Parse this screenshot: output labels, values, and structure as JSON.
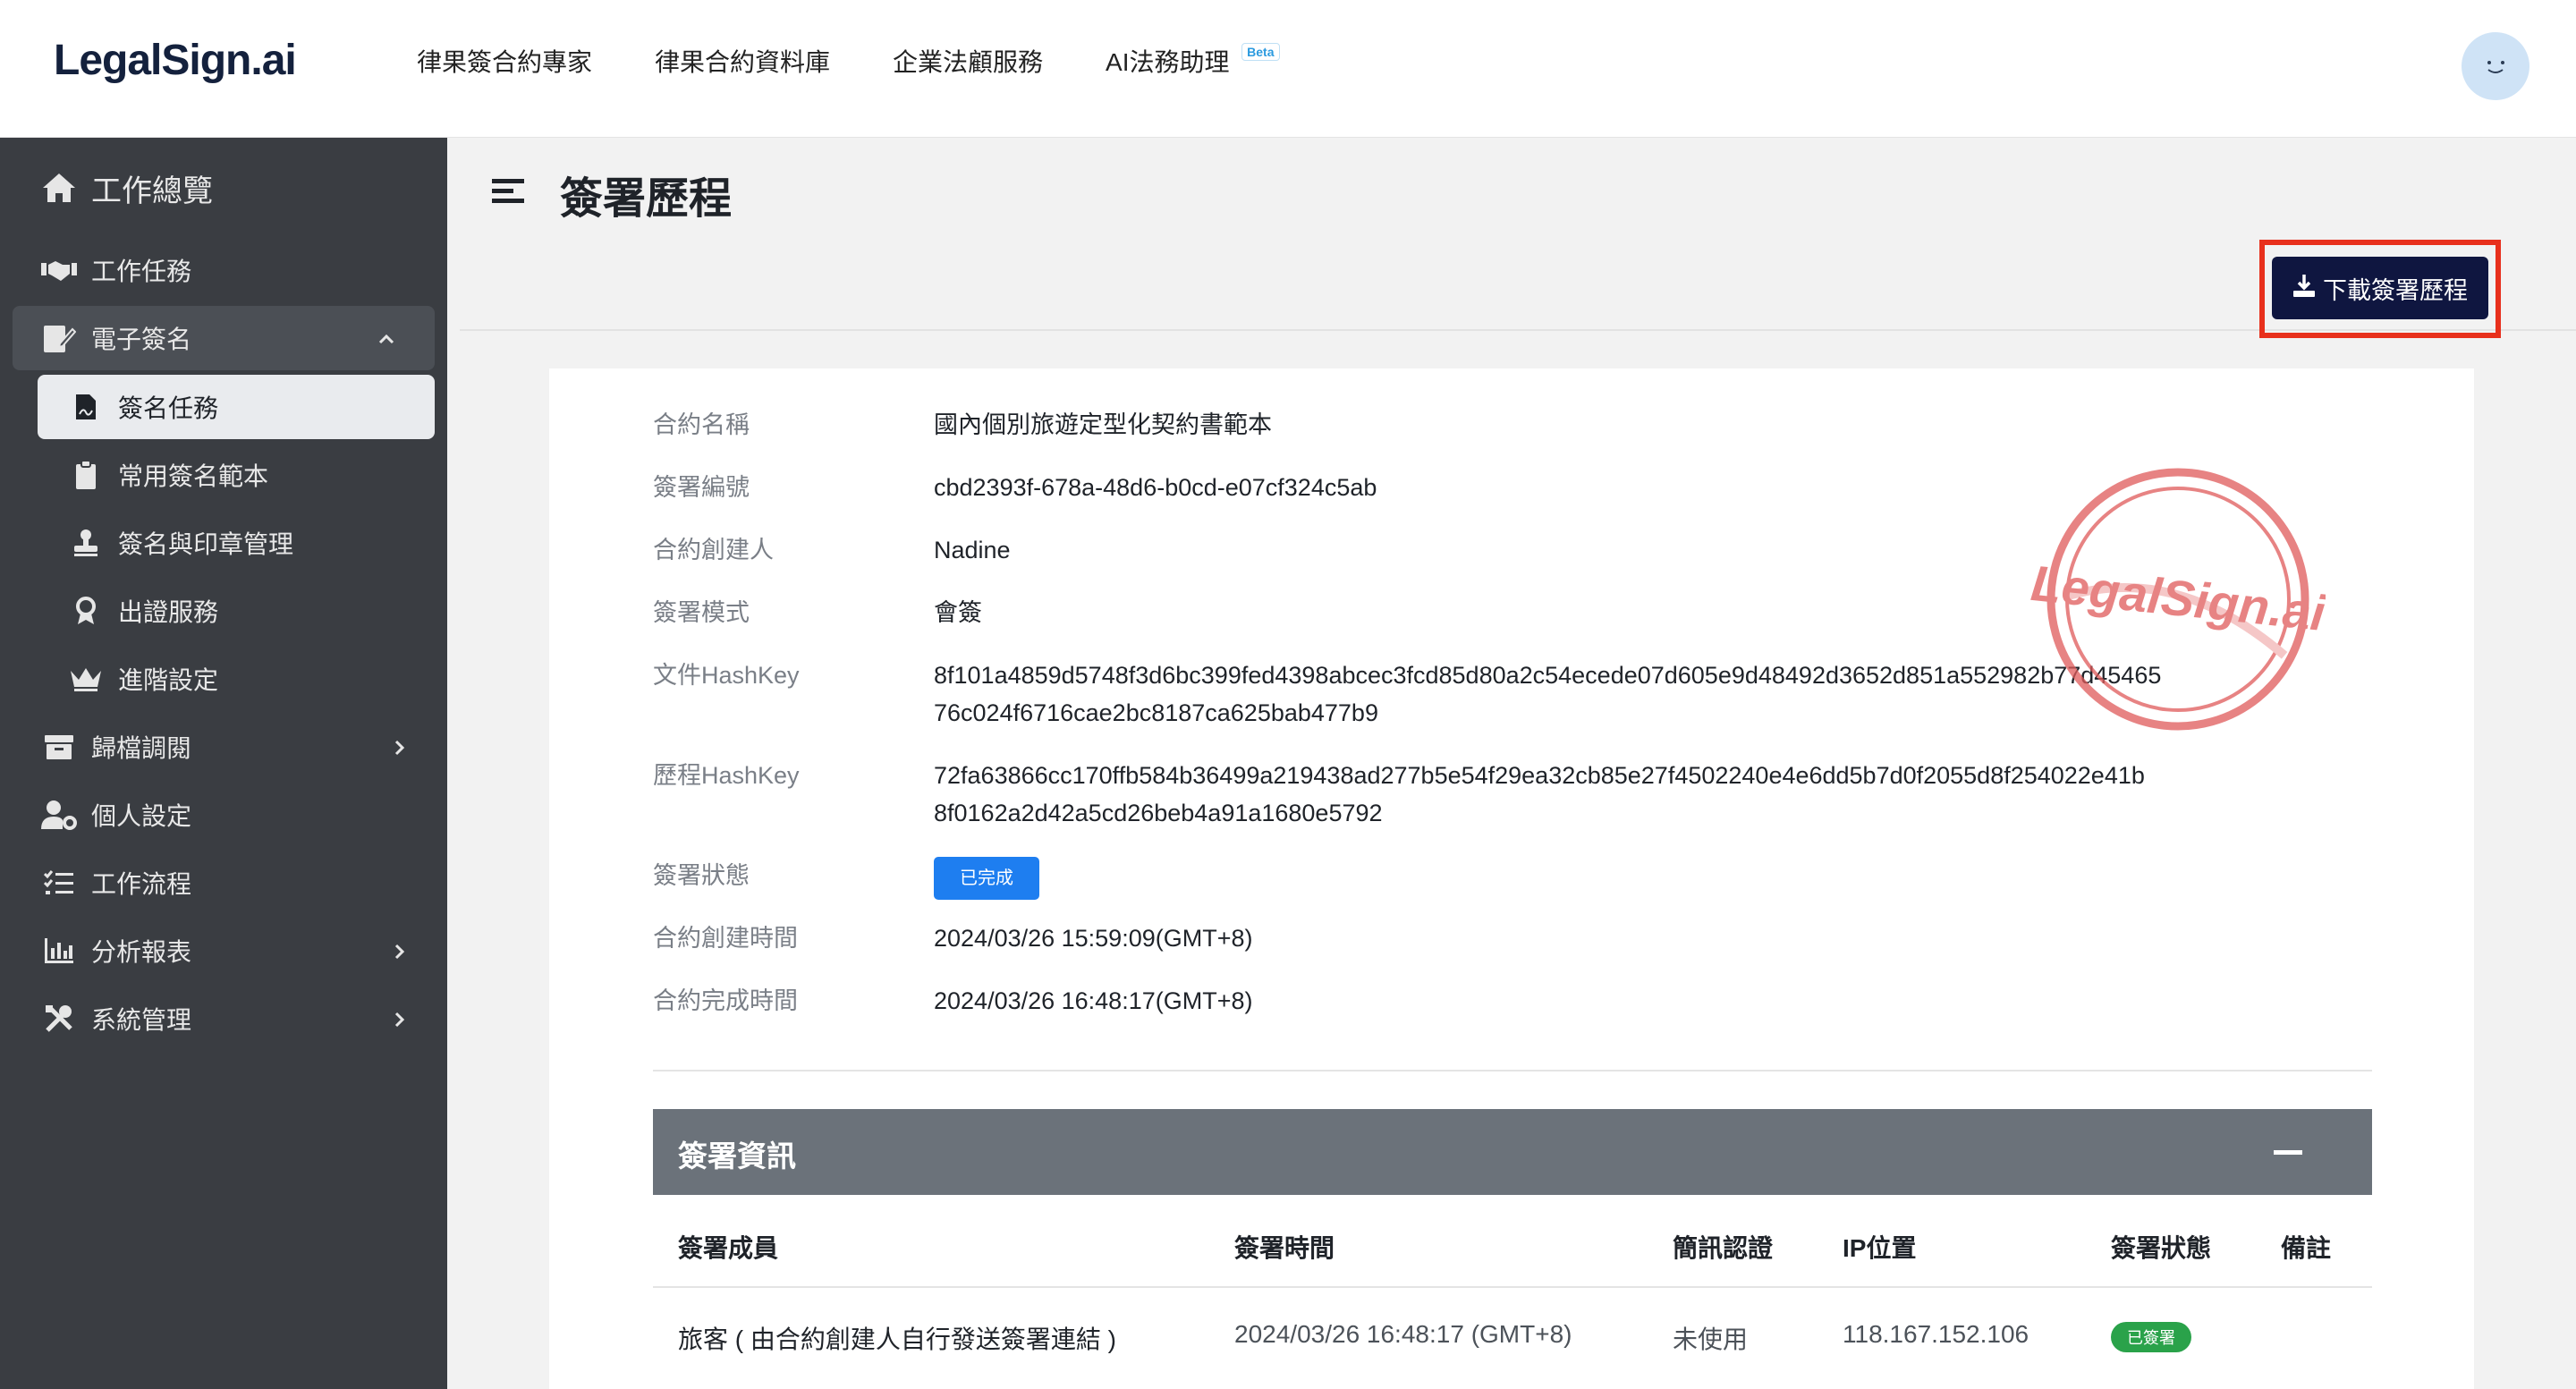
{
  "brand": {
    "logo": "LegalSign.ai"
  },
  "topnav": [
    {
      "label": "律果簽合約專家"
    },
    {
      "label": "律果合約資料庫"
    },
    {
      "label": "企業法顧服務"
    },
    {
      "label": "AI法務助理",
      "badge": "Beta"
    }
  ],
  "sidebar": {
    "items": [
      {
        "label": "工作總覽",
        "icon": "home-icon"
      },
      {
        "label": "工作任務",
        "icon": "handshake-icon"
      },
      {
        "label": "電子簽名",
        "icon": "sign-edit-icon",
        "expanded": true
      },
      {
        "label": "簽名任務",
        "icon": "file-signature-icon",
        "active": true
      },
      {
        "label": "常用簽名範本",
        "icon": "clipboard-icon"
      },
      {
        "label": "簽名與印章管理",
        "icon": "stamp-icon"
      },
      {
        "label": "出證服務",
        "icon": "certificate-icon"
      },
      {
        "label": "進階設定",
        "icon": "crown-icon"
      },
      {
        "label": "歸檔調閱",
        "icon": "archive-icon"
      },
      {
        "label": "個人設定",
        "icon": "user-cog-icon"
      },
      {
        "label": "工作流程",
        "icon": "list-check-icon"
      },
      {
        "label": "分析報表",
        "icon": "bar-chart-icon"
      },
      {
        "label": "系統管理",
        "icon": "tools-icon"
      }
    ]
  },
  "page": {
    "title": "簽署歷程",
    "download_label": "下載簽署歷程"
  },
  "details": {
    "contract_name_label": "合約名稱",
    "contract_name": "國內個別旅遊定型化契約書範本",
    "sign_id_label": "簽署編號",
    "sign_id": "cbd2393f-678a-48d6-b0cd-e07cf324c5ab",
    "creator_label": "合約創建人",
    "creator": "Nadine",
    "mode_label": "簽署模式",
    "mode": "會簽",
    "doc_hash_label": "文件HashKey",
    "doc_hash_line1": "8f101a4859d5748f3d6bc399fed4398abcec3fcd85d80a2c54ecede07d605e9d48492d3652d851a552982b77d45465",
    "doc_hash_line2": "76c024f6716cae2bc8187ca625bab477b9",
    "history_hash_label": "歷程HashKey",
    "history_hash_line1": "72fa63866cc170ffb584b36499a219438ad277b5e54f29ea32cb85e27f4502240e4e6dd5b7d0f2055d8f254022e41b",
    "history_hash_line2": "8f0162a2d42a5cd26beb4a91a1680e5792",
    "status_label": "簽署狀態",
    "status": "已完成",
    "created_label": "合約創建時間",
    "created": "2024/03/26 15:59:09(GMT+8)",
    "completed_label": "合約完成時間",
    "completed": "2024/03/26 16:48:17(GMT+8)",
    "stamp_text": "LegalSign.ai"
  },
  "sign_info": {
    "title": "簽署資訊",
    "columns": [
      "簽署成員",
      "簽署時間",
      "簡訊認證",
      "IP位置",
      "簽署狀態",
      "備註"
    ],
    "rows": [
      {
        "member": "旅客 ( 由合約創建人自行發送簽署連結 )",
        "time": "2024/03/26 16:48:17 (GMT+8)",
        "sms": "未使用",
        "ip": "118.167.152.106",
        "status": "已簽署",
        "note": ""
      }
    ]
  },
  "colors": {
    "sidebar_bg": "#3a3d42",
    "primary_dark": "#0f1640",
    "highlight_frame": "#e8301c",
    "status_blue": "#1e7ef0",
    "status_green": "#2aa24a",
    "stamp_red": "#e05a5a"
  }
}
